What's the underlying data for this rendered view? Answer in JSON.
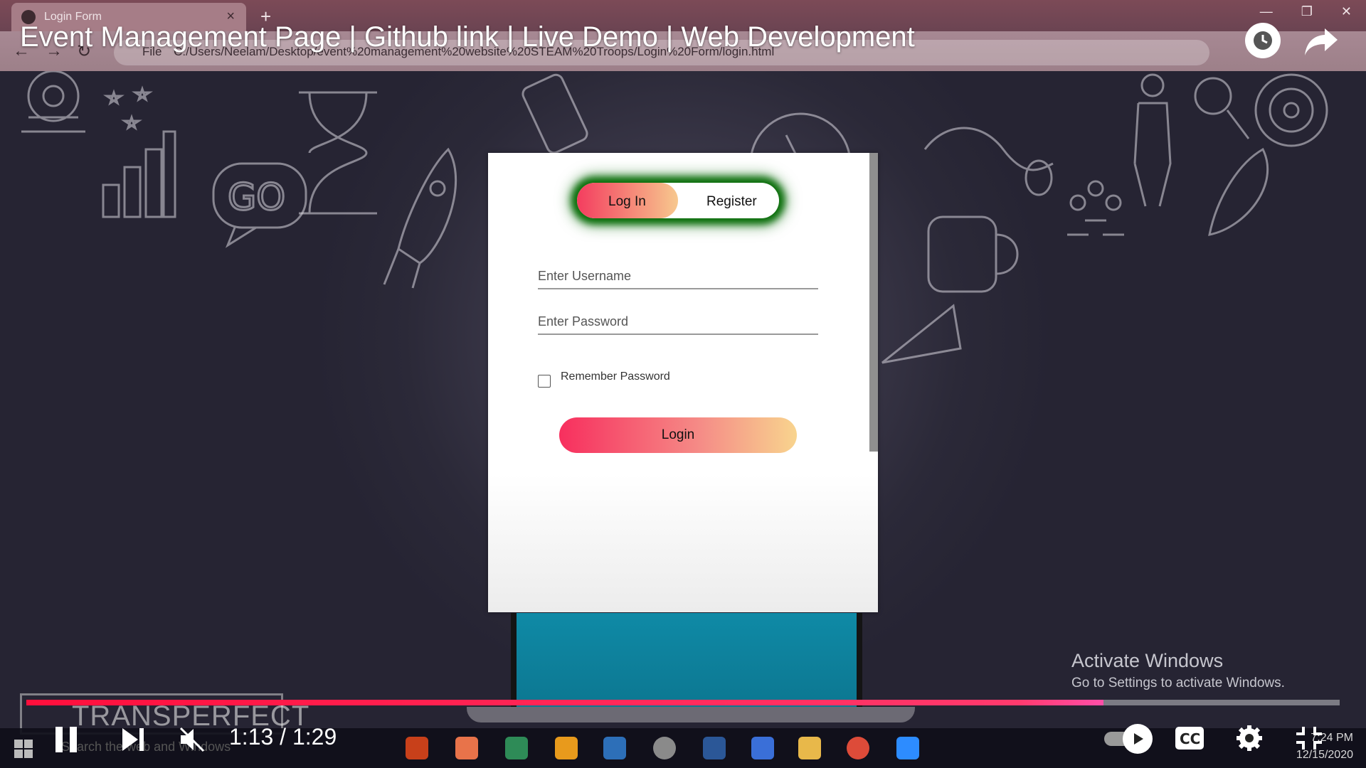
{
  "video": {
    "title": "Event Management Page | Github link | Live Demo | Web Development",
    "time": "1:13 / 1:29",
    "progress": 0.82
  },
  "browser": {
    "tab_title": "Login Form",
    "tab_close": "×",
    "new_tab": "+",
    "url": "C:/Users/Neelam/Desktop/event%20management%20website%20STEAM%20Troops/Login%20Form/login.html",
    "url_scheme": "File"
  },
  "auth_toggle": {
    "login_label": "Log In",
    "register_label": "Register"
  },
  "form": {
    "username_placeholder": "Enter Username",
    "password_placeholder": "Enter Password",
    "remember_label": "Remember Password",
    "login_button": "Login"
  },
  "watermark": {
    "title": "Activate Windows",
    "subtitle": "Go to Settings to activate Windows."
  },
  "brand": "TRANSPERFECT",
  "taskbar": {
    "search_placeholder": "Search the web and Windows",
    "time": "7:24 PM",
    "date": "12/15/2020"
  },
  "colors": {
    "toggle_glow": "#0b6e0b",
    "gradient_start": "#f43d5f",
    "gradient_end": "#f7c88e",
    "progress": "#ff0f3c"
  }
}
